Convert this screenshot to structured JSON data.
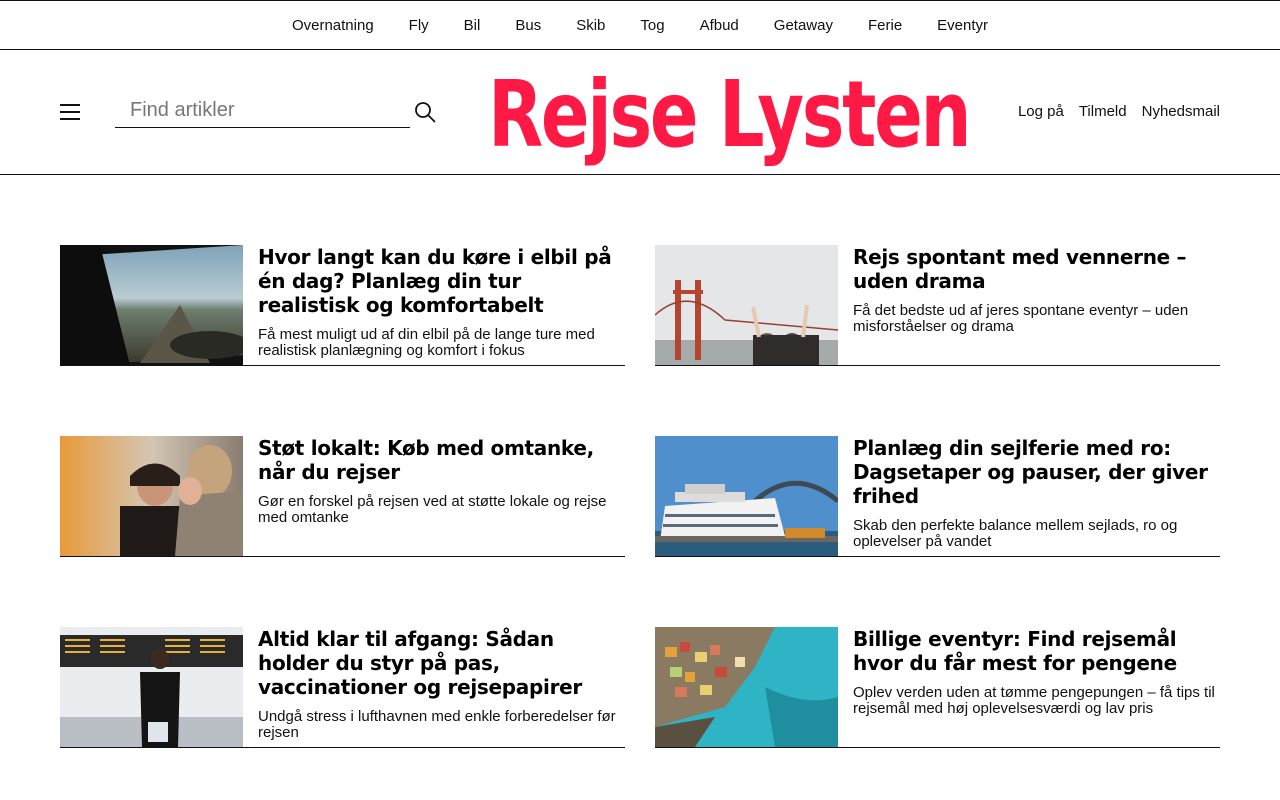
{
  "topnav": {
    "items": [
      "Overnatning",
      "Fly",
      "Bil",
      "Bus",
      "Skib",
      "Tog",
      "Afbud",
      "Getaway",
      "Ferie",
      "Eventyr"
    ]
  },
  "header": {
    "search_placeholder": "Find artikler",
    "logo_text": "Rejse Lysten",
    "logo_color": "#ff1a45",
    "account": {
      "login": "Log på",
      "signup": "Tilmeld",
      "newsletter": "Nyhedsmail"
    }
  },
  "articles": [
    {
      "title": "Hvor langt kan du køre i elbil på én dag? Planlæg din tur realistisk og komfortabelt",
      "description": "Få mest muligt ud af din elbil på de lange ture med realistisk planlægning og komfort i fokus",
      "image": "car-window-road-photo"
    },
    {
      "title": "Rejs spontant med vennerne – uden drama",
      "description": "Få det bedste ud af jeres spontane eventyr – uden misforståelser og drama",
      "image": "golden-gate-friends-photo"
    },
    {
      "title": "Støt lokalt: Køb med omtanke, når du rejser",
      "description": "Gør en forskel på rejsen ved at støtte lokale og rejse med omtanke",
      "image": "smiling-friends-photo"
    },
    {
      "title": "Planlæg din sejlferie med ro: Dagsetaper og pauser, der giver frihed",
      "description": "Skab den perfekte balance mellem sejlads, ro og oplevelser på vandet",
      "image": "cruise-ship-sydney-photo"
    },
    {
      "title": "Altid klar til afgang: Sådan holder du styr på pas, vaccinationer og rejsepapirer",
      "description": "Undgå stress i lufthavnen med enkle forberedelser før rejsen",
      "image": "airport-departures-photo"
    },
    {
      "title": "Billige eventyr: Find rejsemål hvor du får mest for pengene",
      "description": "Oplev verden uden at tømme pengepungen – få tips til rejsemål med høj oplevelsesværdi og lav pris",
      "image": "cinque-terre-coast-photo"
    }
  ]
}
